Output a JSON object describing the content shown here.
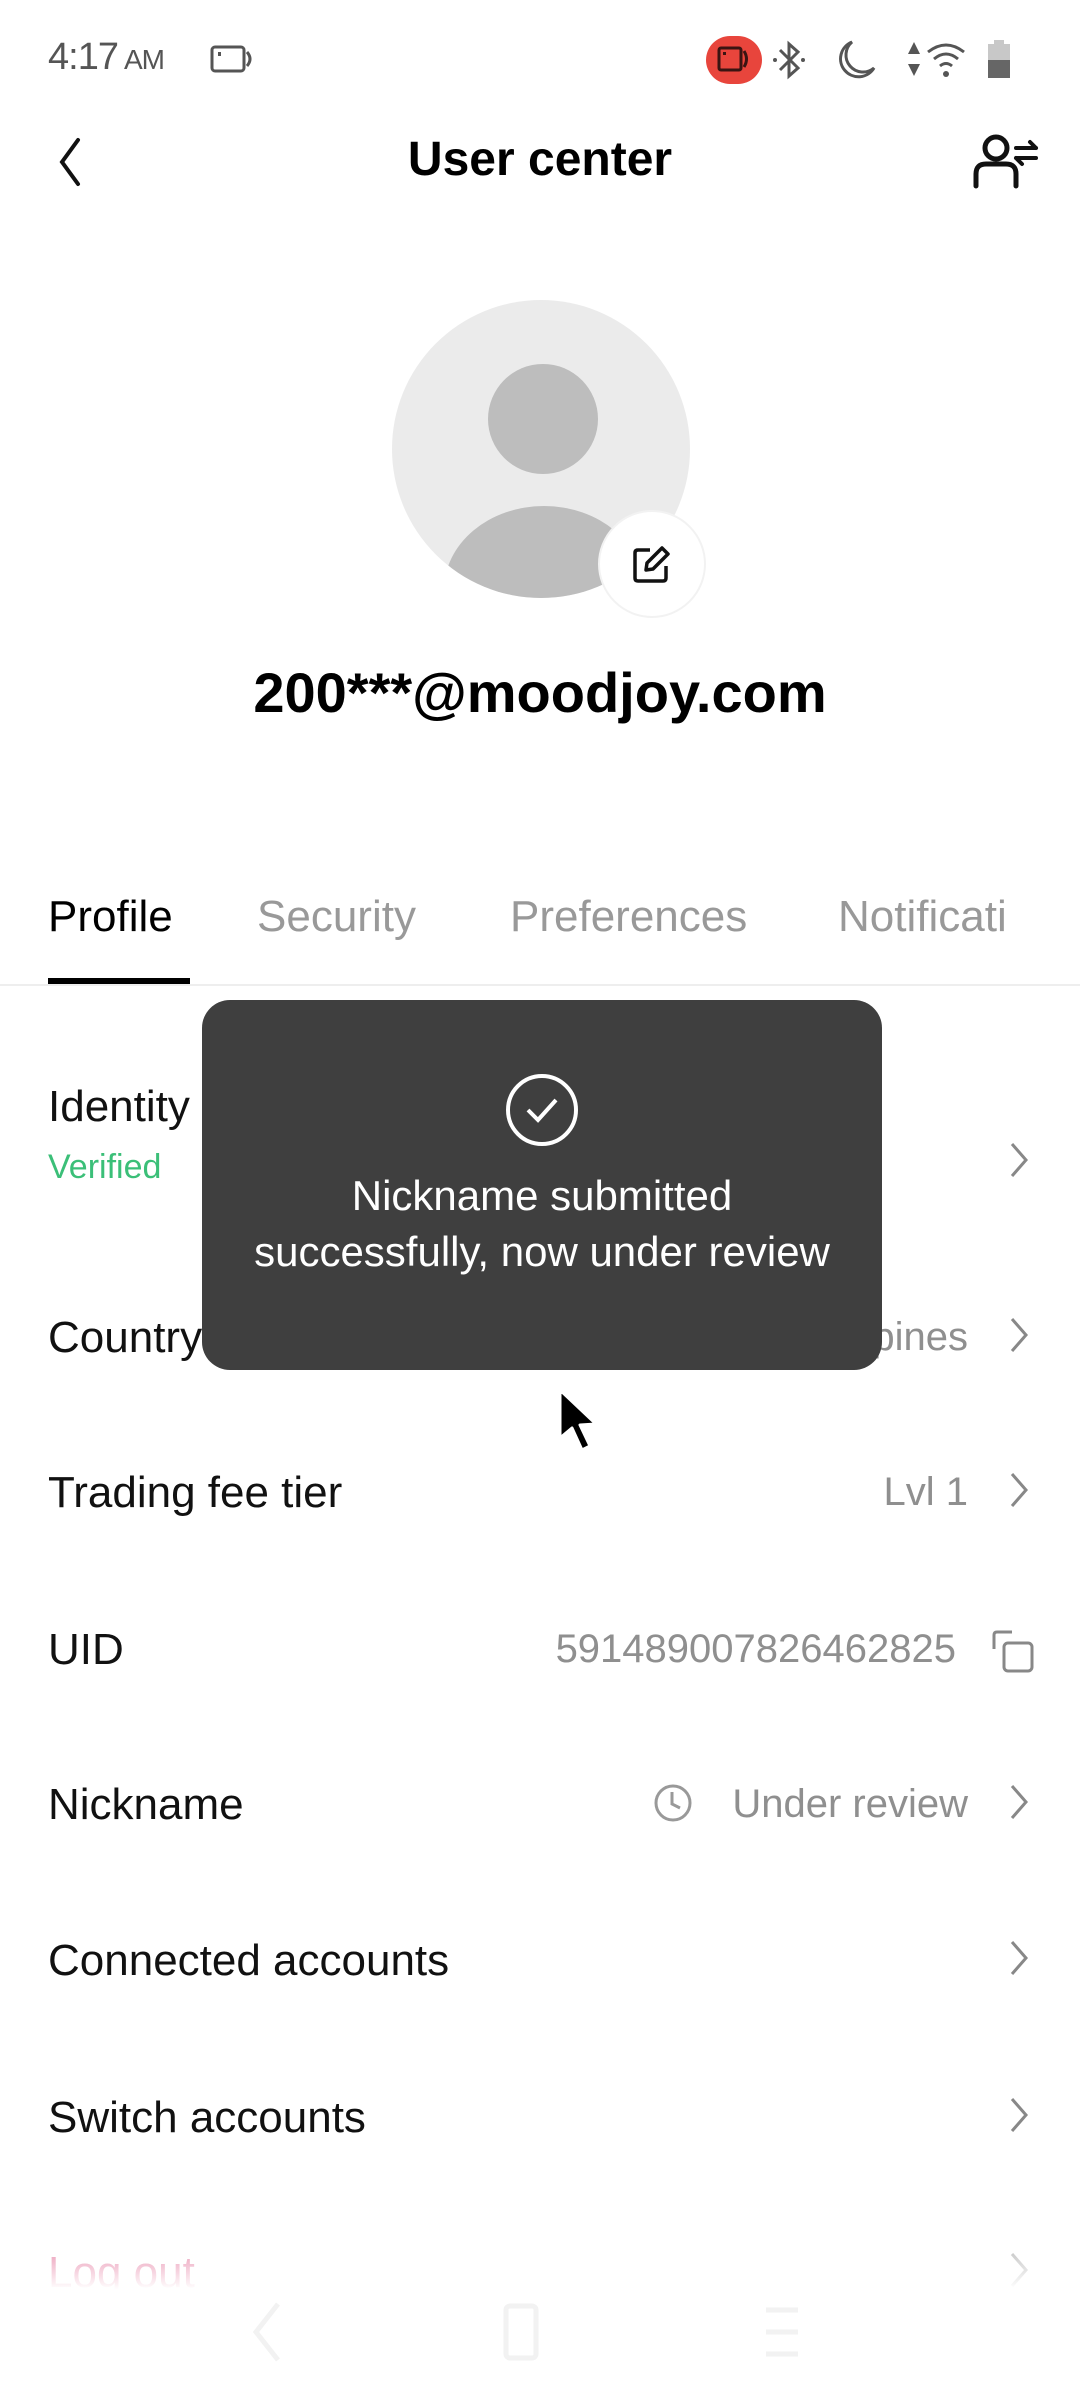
{
  "status_bar": {
    "time": "4:17",
    "ampm": "AM",
    "icons": [
      "screen-record-icon",
      "recording-indicator-icon",
      "bluetooth-icon",
      "do-not-disturb-icon",
      "data-arrows-icon",
      "wifi-icon",
      "battery-icon"
    ],
    "recording_color": "#e8453c"
  },
  "header": {
    "title": "User center",
    "back_icon": "chevron-left-icon",
    "right_icon": "switch-user-icon"
  },
  "profile": {
    "email": "200***@moodjoy.com",
    "avatar_icon": "default-avatar-icon",
    "edit_icon": "edit-icon"
  },
  "tabs": [
    {
      "label": "Profile",
      "active": true
    },
    {
      "label": "Security",
      "active": false
    },
    {
      "label": "Preferences",
      "active": false
    },
    {
      "label": "Notificati",
      "active": false
    }
  ],
  "rows": [
    {
      "label": "Identity",
      "sub": "Verified",
      "value": ""
    },
    {
      "label": "Country",
      "value": "pines"
    },
    {
      "label": "Trading fee tier",
      "value": "Lvl 1"
    },
    {
      "label": "UID",
      "value": "591489007826462825"
    },
    {
      "label": "Nickname",
      "value": "Under review"
    },
    {
      "label": "Connected accounts",
      "value": ""
    },
    {
      "label": "Switch accounts",
      "value": ""
    },
    {
      "label": "Log out",
      "value": ""
    }
  ],
  "colors": {
    "verified": "#3bbf78",
    "logout": "#d6336c",
    "toast_bg": "#3f3f3f"
  },
  "toast": {
    "icon": "check-circle-icon",
    "message": "Nickname submitted successfully, now under review"
  }
}
